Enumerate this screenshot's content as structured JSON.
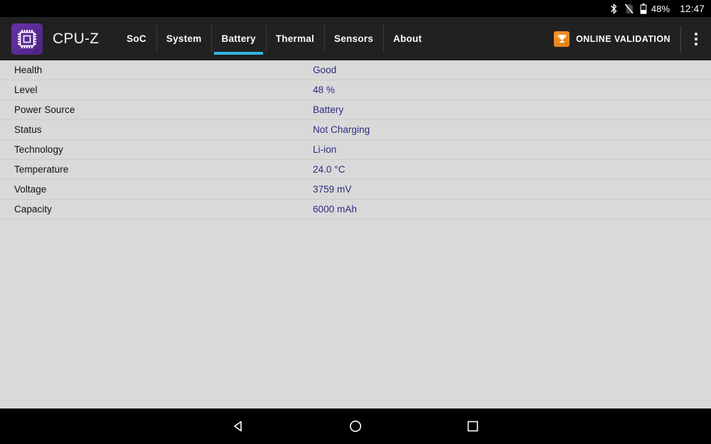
{
  "status_bar": {
    "icons": [
      {
        "name": "bluetooth-icon",
        "label": "Bluetooth"
      },
      {
        "name": "no-sim-icon",
        "label": "No SIM"
      },
      {
        "name": "battery-icon",
        "label": "Battery"
      }
    ],
    "battery_percent": "48%",
    "clock": "12:47"
  },
  "app_bar": {
    "logo_name": "cpu-chip-icon",
    "title": "CPU-Z",
    "tabs": [
      {
        "label": "SoC",
        "active": false
      },
      {
        "label": "System",
        "active": false
      },
      {
        "label": "Battery",
        "active": true
      },
      {
        "label": "Thermal",
        "active": false
      },
      {
        "label": "Sensors",
        "active": false
      },
      {
        "label": "About",
        "active": false
      }
    ],
    "validation": {
      "icon_name": "trophy-icon",
      "label": "ONLINE VALIDATION"
    },
    "overflow_label": "More options"
  },
  "battery_info": {
    "rows": [
      {
        "label": "Health",
        "value": "Good"
      },
      {
        "label": "Level",
        "value": "48 %"
      },
      {
        "label": "Power Source",
        "value": "Battery"
      },
      {
        "label": "Status",
        "value": "Not Charging"
      },
      {
        "label": "Technology",
        "value": "Li-ion"
      },
      {
        "label": "Temperature",
        "value": "24.0 °C"
      },
      {
        "label": "Voltage",
        "value": "3759 mV"
      },
      {
        "label": "Capacity",
        "value": "6000 mAh"
      }
    ]
  },
  "nav_bar": {
    "back_label": "Back",
    "home_label": "Home",
    "recents_label": "Recents"
  },
  "colors": {
    "accent_cyan": "#35b5e5",
    "app_bar_bg": "#212121",
    "content_bg": "#d9d9d9",
    "value_text": "#2b2b80",
    "logo_purple": "#5c2d91",
    "validation_orange": "#f08a1e"
  }
}
